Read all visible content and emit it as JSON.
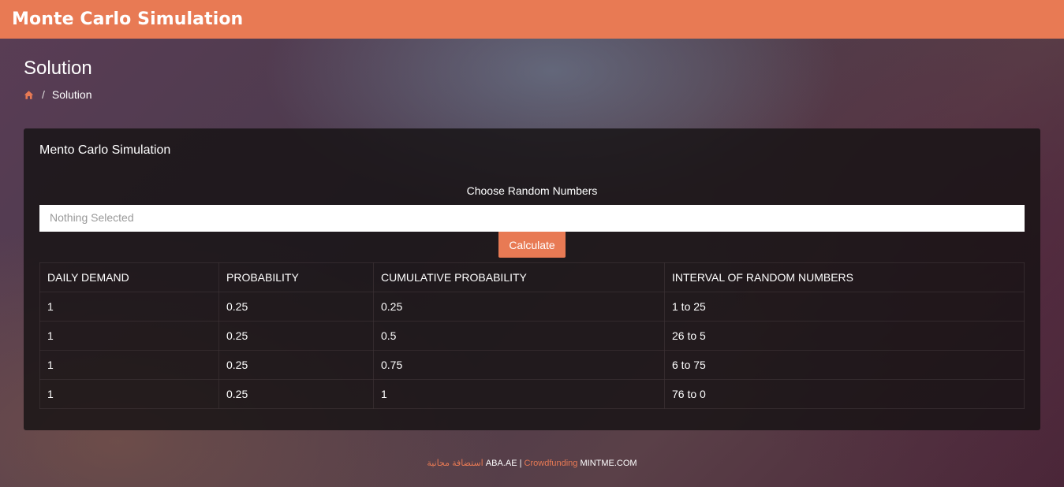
{
  "app": {
    "title": "Monte Carlo Simulation"
  },
  "page": {
    "title": "Solution",
    "breadcrumb": {
      "home_icon": "home-icon",
      "current": "Solution",
      "separator": "/"
    }
  },
  "panel": {
    "title": "Mento Carlo Simulation",
    "choose_label": "Choose Random Numbers",
    "select": {
      "value": "Nothing Selected"
    },
    "calculate_label": "Calculate"
  },
  "table": {
    "headers": [
      "DAILY DEMAND",
      "PROBABILITY",
      "CUMULATIVE PROBABILITY",
      "INTERVAL OF RANDOM NUMBERS"
    ],
    "rows": [
      [
        "1",
        "0.25",
        "0.25",
        "1 to 25"
      ],
      [
        "1",
        "0.25",
        "0.5",
        "26 to 5"
      ],
      [
        "1",
        "0.25",
        "0.75",
        "6 to 75"
      ],
      [
        "1",
        "0.25",
        "1",
        "76 to 0"
      ]
    ]
  },
  "footer": {
    "arabic": "استضافة مجانية",
    "site1": "ABA.AE",
    "divider": "|",
    "link": "Crowdfunding",
    "site2": "MINTME.COM"
  },
  "colors": {
    "accent": "#e87a54",
    "panel": "#1a1516"
  }
}
